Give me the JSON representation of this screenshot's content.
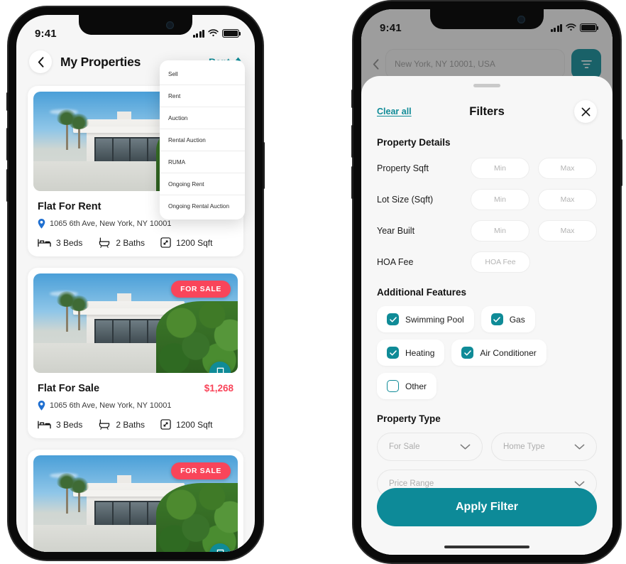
{
  "status_bar": {
    "time": "9:41",
    "signal_icon": "signal-bars-icon",
    "wifi_icon": "wifi-icon",
    "battery_icon": "battery-icon"
  },
  "left_phone": {
    "header": {
      "back_icon": "chevron-left-icon",
      "title": "My Properties",
      "sort_label": "Rent",
      "sort_icon": "sort-updown-icon"
    },
    "dropdown": {
      "items": [
        {
          "label": "Sell"
        },
        {
          "label": "Rent"
        },
        {
          "label": "Auction"
        },
        {
          "label": "Rental Auction"
        },
        {
          "label": "RUMA"
        },
        {
          "label": "Ongoing Rent"
        },
        {
          "label": "Ongoing Rental Auction"
        }
      ]
    },
    "cards": [
      {
        "title": "Flat For Rent",
        "price": "",
        "badge": "",
        "address": "1065 6th Ave, New York, NY 10001",
        "specs": [
          {
            "icon": "bed-icon",
            "label": "3 Beds"
          },
          {
            "icon": "bath-icon",
            "label": "2 Baths"
          },
          {
            "icon": "area-icon",
            "label": "1200 Sqft"
          }
        ]
      },
      {
        "title": "Flat For Sale",
        "price": "$1,268",
        "badge": "FOR SALE",
        "address": "1065 6th Ave, New York, NY 10001",
        "specs": [
          {
            "icon": "bed-icon",
            "label": "3 Beds"
          },
          {
            "icon": "bath-icon",
            "label": "2 Baths"
          },
          {
            "icon": "area-icon",
            "label": "1200 Sqft"
          }
        ]
      },
      {
        "title": "",
        "price": "",
        "badge": "FOR SALE",
        "address": "",
        "specs": []
      }
    ]
  },
  "right_phone": {
    "background": {
      "back_icon": "chevron-left-icon",
      "search_placeholder": "New York, NY 10001, USA",
      "filter_icon": "filter-icon"
    },
    "sheet": {
      "clear_all": "Clear all",
      "title": "Filters",
      "close_icon": "close-icon",
      "sections": {
        "property_details": {
          "title": "Property Details",
          "rows": [
            {
              "label": "Property Sqft",
              "min_placeholder": "Min",
              "max_placeholder": "Max",
              "value_min": "",
              "value_max": ""
            },
            {
              "label": "Lot Size (Sqft)",
              "min_placeholder": "Min",
              "max_placeholder": "Max",
              "value_min": "",
              "value_max": ""
            },
            {
              "label": "Year Built",
              "min_placeholder": "Min",
              "max_placeholder": "Max",
              "value_min": "",
              "value_max": ""
            }
          ],
          "hoa": {
            "label": "HOA Fee",
            "placeholder": "HOA Fee",
            "value": ""
          }
        },
        "additional_features": {
          "title": "Additional Features",
          "items": [
            {
              "label": "Swimming Pool",
              "checked": true
            },
            {
              "label": "Gas",
              "checked": true
            },
            {
              "label": "Heating",
              "checked": true
            },
            {
              "label": "Air Conditioner",
              "checked": true
            },
            {
              "label": "Other",
              "checked": false
            }
          ]
        },
        "property_type": {
          "title": "Property Type",
          "selects": [
            {
              "placeholder": "For Sale",
              "value": "",
              "icon": "chevron-down-icon"
            },
            {
              "placeholder": "Home Type",
              "value": "",
              "icon": "chevron-down-icon"
            },
            {
              "placeholder": "Price Range",
              "value": "",
              "icon": "chevron-down-icon"
            }
          ]
        }
      },
      "apply_label": "Apply Filter"
    }
  },
  "colors": {
    "accent_teal": "#0f8b97",
    "apply_teal": "#0d8a98",
    "badge_red": "#f9455a",
    "price_red": "#f9455a"
  }
}
